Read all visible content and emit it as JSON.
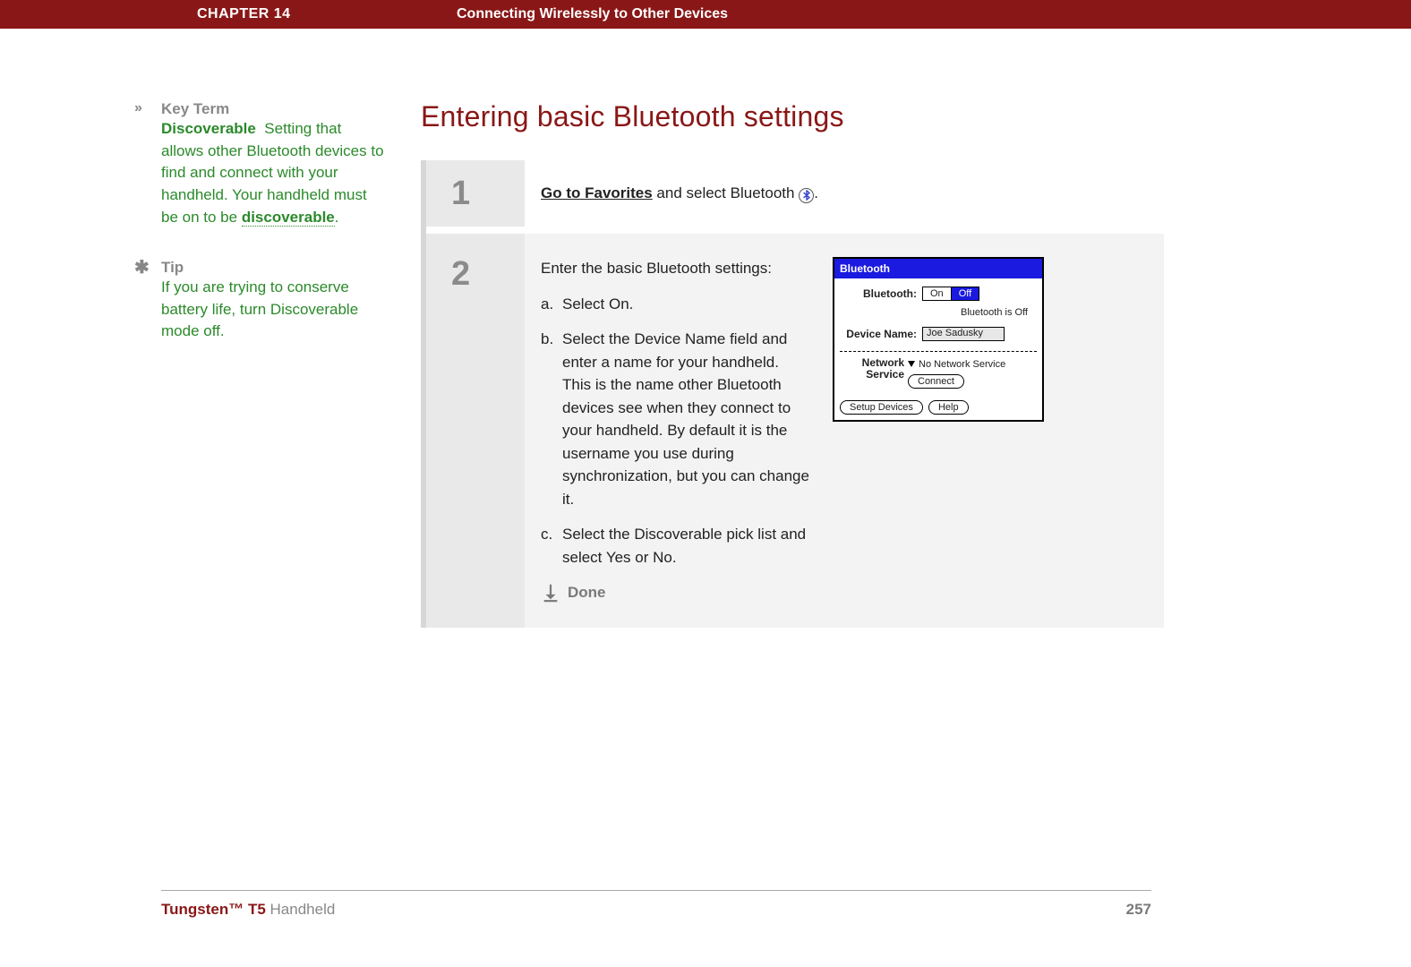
{
  "header": {
    "chapter": "CHAPTER 14",
    "title": "Connecting Wirelessly to Other Devices"
  },
  "sidebar": {
    "keyterm": {
      "label": "Key Term",
      "term": "Discoverable",
      "definition_tail": "Setting that allows other Bluetooth devices to find and connect with your handheld. Your handheld must be on to be ",
      "link_word": "discoverable",
      "period": "."
    },
    "tip": {
      "label": "Tip",
      "text": "If you are trying to conserve battery life, turn Discoverable mode off."
    }
  },
  "main": {
    "section_title": "Entering basic Bluetooth settings",
    "step1": {
      "num": "1",
      "link": "Go to Favorites",
      "tail_a": " and select Bluetooth ",
      "tail_b": "."
    },
    "step2": {
      "num": "2",
      "intro": "Enter the basic Bluetooth settings:",
      "a_letter": "a.",
      "a_text": "Select On.",
      "b_letter": "b.",
      "b_text": "Select the Device Name field and enter a name for your handheld. This is the name other Bluetooth devices see when they connect to your handheld. By default it is the username you use during synchronization, but you can change it.",
      "c_letter": "c.",
      "c_text": "Select the Discoverable pick list and select Yes or No.",
      "done": "Done"
    }
  },
  "device": {
    "title": "Bluetooth",
    "row_bt_label": "Bluetooth:",
    "on": "On",
    "off": "Off",
    "status": "Bluetooth is Off",
    "row_name_label": "Device Name:",
    "name_value": "Joe Sadusky",
    "net_label_1": "Network",
    "net_label_2": "Service",
    "net_value": "No Network Service",
    "connect_btn": "Connect",
    "setup_btn": "Setup Devices",
    "help_btn": "Help"
  },
  "footer": {
    "product_bold": "Tungsten™ T5",
    "product_tail": " Handheld",
    "page": "257"
  }
}
